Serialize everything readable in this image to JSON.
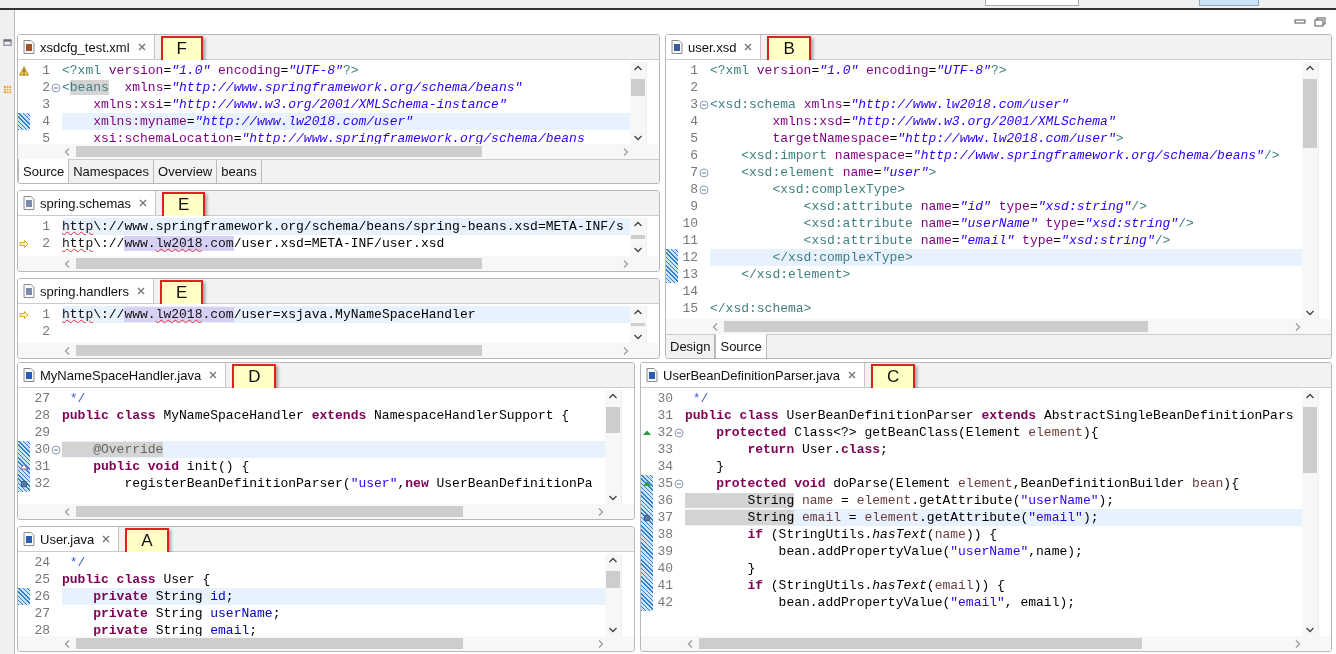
{
  "top": {
    "left": [
      {
        "file": "xsdcfg_test.xml",
        "kind": "xml",
        "callout": "F",
        "lines": [
          {
            "no": "1",
            "markers": [
              {
                "kind": "warning"
              }
            ],
            "fold": false,
            "current": false,
            "tokens": [
              {
                "kind": "tag",
                "text": "<?xml "
              },
              {
                "kind": "attr",
                "text": "version"
              },
              {
                "kind": "plain",
                "text": "="
              },
              {
                "kind": "string",
                "text": "\"1.0\""
              },
              {
                "kind": "attr",
                "text": " encoding"
              },
              {
                "kind": "plain",
                "text": "="
              },
              {
                "kind": "string",
                "text": "\"UTF-8\""
              },
              {
                "kind": "tag",
                "text": "?>"
              }
            ]
          },
          {
            "no": "2",
            "fold": true,
            "current": false,
            "tokens": [
              {
                "kind": "tag",
                "text": "<"
              },
              {
                "kind": "tag_occurrence",
                "text": "beans"
              },
              {
                "kind": "attr",
                "text": "  xmlns"
              },
              {
                "kind": "plain",
                "text": "="
              },
              {
                "kind": "string",
                "text": "\"http://www.springframework.org/schema/beans\""
              }
            ]
          },
          {
            "no": "3",
            "fold": false,
            "current": false,
            "tokens": [
              {
                "kind": "attr",
                "text": "    xmlns:xsi"
              },
              {
                "kind": "plain",
                "text": "="
              },
              {
                "kind": "string",
                "text": "\"http://www.w3.org/2001/XMLSchema-instance\""
              }
            ]
          },
          {
            "no": "4",
            "markers": [
              {
                "kind": "hatch"
              }
            ],
            "fold": false,
            "current": true,
            "tokens": [
              {
                "kind": "attr",
                "text": "    xmlns:myname"
              },
              {
                "kind": "plain",
                "text": "="
              },
              {
                "kind": "string",
                "text": "\"http://www.lw2018.com/user\""
              }
            ]
          },
          {
            "no": "5",
            "fold": false,
            "current": false,
            "tokens": [
              {
                "kind": "attr",
                "text": "    xsi:schemaLocation"
              },
              {
                "kind": "plain",
                "text": "="
              },
              {
                "kind": "string",
                "text": "\"http://www.springframework.org/schema/beans"
              }
            ]
          }
        ],
        "pages": [
          {
            "label": "Source",
            "selected": true
          },
          {
            "label": "Namespaces",
            "selected": false
          },
          {
            "label": "Overview",
            "selected": false
          },
          {
            "label": "beans",
            "selected": false
          }
        ]
      },
      {
        "file": "spring.schemas",
        "kind": "text",
        "callout": "E",
        "lines": [
          {
            "no": "1",
            "fold": false,
            "current": true,
            "tokens": [
              {
                "kind": "squiggle",
                "text": "http"
              },
              {
                "kind": "plain",
                "text": "\\://www.springframework.org/schema/beans/spring-beans.xsd=META-INF/s"
              }
            ]
          },
          {
            "no": "2",
            "markers": [
              {
                "kind": "arrow"
              }
            ],
            "fold": false,
            "current": false,
            "tokens": [
              {
                "kind": "squiggle",
                "text": "http"
              },
              {
                "kind": "plain",
                "text": "\\://"
              },
              {
                "kind": "selected",
                "text": "www."
              },
              {
                "kind": "selected_squiggle",
                "text": "lw2018"
              },
              {
                "kind": "selected",
                "text": ".com"
              },
              {
                "kind": "plain",
                "text": "/user.xsd=META-INF/user.xsd"
              }
            ]
          }
        ]
      },
      {
        "file": "spring.handlers",
        "kind": "text",
        "callout": "E",
        "lines": [
          {
            "no": "1",
            "markers": [
              {
                "kind": "arrow"
              }
            ],
            "fold": false,
            "current": true,
            "tokens": [
              {
                "kind": "squiggle",
                "text": "http"
              },
              {
                "kind": "plain",
                "text": "\\://"
              },
              {
                "kind": "selected",
                "text": "www."
              },
              {
                "kind": "selected_squiggle",
                "text": "lw2018"
              },
              {
                "kind": "selected",
                "text": ".com"
              },
              {
                "kind": "plain",
                "text": "/user=xsjava.MyNameSpaceHandler"
              }
            ]
          },
          {
            "no": "2",
            "fold": false,
            "current": false
          }
        ]
      }
    ],
    "right": [
      {
        "file": "user.xsd",
        "kind": "xsd",
        "callout": "B",
        "lines": [
          {
            "no": "1",
            "fold": false,
            "current": false,
            "tokens": [
              {
                "kind": "tag",
                "text": "<?xml "
              },
              {
                "kind": "attr",
                "text": "version"
              },
              {
                "kind": "plain",
                "text": "="
              },
              {
                "kind": "string",
                "text": "\"1.0\""
              },
              {
                "kind": "attr",
                "text": " encoding"
              },
              {
                "kind": "plain",
                "text": "="
              },
              {
                "kind": "string",
                "text": "\"UTF-8\""
              },
              {
                "kind": "tag",
                "text": "?>"
              }
            ]
          },
          {
            "no": "2",
            "fold": false,
            "current": false
          },
          {
            "no": "3",
            "fold": true,
            "current": false,
            "tokens": [
              {
                "kind": "tag",
                "text": "<xsd:schema "
              },
              {
                "kind": "attr",
                "text": "xmlns"
              },
              {
                "kind": "plain",
                "text": "="
              },
              {
                "kind": "string",
                "text": "\"http://www.lw2018.com/user\""
              }
            ]
          },
          {
            "no": "4",
            "fold": false,
            "current": false,
            "tokens": [
              {
                "kind": "attr",
                "text": "        xmlns:xsd"
              },
              {
                "kind": "plain",
                "text": "="
              },
              {
                "kind": "string",
                "text": "\"http://www.w3.org/2001/XMLSchema\""
              }
            ]
          },
          {
            "no": "5",
            "fold": false,
            "current": false,
            "tokens": [
              {
                "kind": "attr",
                "text": "        targetNamespace"
              },
              {
                "kind": "plain",
                "text": "="
              },
              {
                "kind": "string",
                "text": "\"http://www.lw2018.com/user\""
              },
              {
                "kind": "tag",
                "text": ">"
              }
            ]
          },
          {
            "no": "6",
            "fold": false,
            "current": false,
            "tokens": [
              {
                "kind": "tag",
                "text": "    <xsd:import "
              },
              {
                "kind": "attr",
                "text": "namespace"
              },
              {
                "kind": "plain",
                "text": "="
              },
              {
                "kind": "string",
                "text": "\"http://www.springframework.org/schema/beans\""
              },
              {
                "kind": "tag",
                "text": "/>"
              }
            ]
          },
          {
            "no": "7",
            "fold": true,
            "current": false,
            "tokens": [
              {
                "kind": "tag",
                "text": "    <xsd:element "
              },
              {
                "kind": "attr",
                "text": "name"
              },
              {
                "kind": "plain",
                "text": "="
              },
              {
                "kind": "string",
                "text": "\"user\""
              },
              {
                "kind": "tag",
                "text": ">"
              }
            ]
          },
          {
            "no": "8",
            "fold": true,
            "current": false,
            "tokens": [
              {
                "kind": "tag",
                "text": "        <xsd:complexType>"
              }
            ]
          },
          {
            "no": "9",
            "fold": false,
            "current": false,
            "tokens": [
              {
                "kind": "tag",
                "text": "            <xsd:attribute "
              },
              {
                "kind": "attr",
                "text": "name"
              },
              {
                "kind": "plain",
                "text": "="
              },
              {
                "kind": "string",
                "text": "\"id\""
              },
              {
                "kind": "attr",
                "text": " type"
              },
              {
                "kind": "plain",
                "text": "="
              },
              {
                "kind": "string",
                "text": "\"xsd:string\""
              },
              {
                "kind": "tag",
                "text": "/>"
              }
            ]
          },
          {
            "no": "10",
            "fold": false,
            "current": false,
            "tokens": [
              {
                "kind": "tag",
                "text": "            <xsd:attribute "
              },
              {
                "kind": "attr",
                "text": "name"
              },
              {
                "kind": "plain",
                "text": "="
              },
              {
                "kind": "string",
                "text": "\"userName\""
              },
              {
                "kind": "attr",
                "text": " type"
              },
              {
                "kind": "plain",
                "text": "="
              },
              {
                "kind": "string",
                "text": "\"xsd:string\""
              },
              {
                "kind": "tag",
                "text": "/>"
              }
            ]
          },
          {
            "no": "11",
            "fold": false,
            "current": false,
            "tokens": [
              {
                "kind": "tag",
                "text": "            <xsd:attribute "
              },
              {
                "kind": "attr",
                "text": "name"
              },
              {
                "kind": "plain",
                "text": "="
              },
              {
                "kind": "string",
                "text": "\"email\""
              },
              {
                "kind": "attr",
                "text": " type"
              },
              {
                "kind": "plain",
                "text": "="
              },
              {
                "kind": "string",
                "text": "\"xsd:string\""
              },
              {
                "kind": "tag",
                "text": "/>"
              }
            ]
          },
          {
            "no": "12",
            "markers": [
              {
                "kind": "hatch"
              }
            ],
            "fold": false,
            "current": true,
            "tokens": [
              {
                "kind": "tag",
                "text": "        </xsd:complexType>"
              }
            ]
          },
          {
            "no": "13",
            "markers": [
              {
                "kind": "hatch"
              }
            ],
            "fold": false,
            "current": false,
            "tokens": [
              {
                "kind": "tag",
                "text": "    </xsd:element>"
              }
            ]
          },
          {
            "no": "14",
            "fold": false,
            "current": false
          },
          {
            "no": "15",
            "fold": false,
            "current": false,
            "tokens": [
              {
                "kind": "tag",
                "text": "</xsd:schema>"
              }
            ]
          }
        ],
        "pages": [
          {
            "label": "Design",
            "selected": false
          },
          {
            "label": "Source",
            "selected": true
          }
        ]
      }
    ]
  },
  "bottom": {
    "left": [
      {
        "file": "MyNameSpaceHandler.java",
        "kind": "java",
        "callout": "D",
        "lines": [
          {
            "no": "27",
            "fold": false,
            "current": false,
            "tokens": [
              {
                "kind": "comment",
                "text": " */"
              }
            ]
          },
          {
            "no": "28",
            "fold": false,
            "current": false,
            "tokens": [
              {
                "kind": "keyword",
                "text": "public"
              },
              {
                "kind": "keyword",
                "text": " class"
              },
              {
                "kind": "plain",
                "text": " MyNameSpaceHandler "
              },
              {
                "kind": "keyword",
                "text": "extends"
              },
              {
                "kind": "plain",
                "text": " NamespaceHandlerSupport {"
              }
            ]
          },
          {
            "no": "29",
            "fold": false,
            "current": false
          },
          {
            "no": "30",
            "markers": [
              {
                "kind": "hatch"
              }
            ],
            "fold": true,
            "current": true,
            "tokens": [
              {
                "kind": "annotation",
                "text": "    @Override"
              }
            ]
          },
          {
            "no": "31",
            "markers": [
              {
                "kind": "hatch"
              },
              {
                "kind": "implements"
              }
            ],
            "fold": false,
            "current": false,
            "tokens": [
              {
                "kind": "keyword",
                "text": "    public"
              },
              {
                "kind": "keyword",
                "text": " void"
              },
              {
                "kind": "plain",
                "text": " init() {"
              }
            ]
          },
          {
            "no": "32",
            "markers": [
              {
                "kind": "hatch"
              },
              {
                "kind": "dot"
              }
            ],
            "fold": false,
            "current": false,
            "tokens": [
              {
                "kind": "plain",
                "text": "        registerBeanDefinitionParser("
              },
              {
                "kind": "java_string",
                "text": "\"user\""
              },
              {
                "kind": "plain",
                "text": ","
              },
              {
                "kind": "keyword",
                "text": "new"
              },
              {
                "kind": "plain",
                "text": " UserBeanDefinitionPa"
              }
            ]
          }
        ]
      },
      {
        "file": "User.java",
        "kind": "java",
        "callout": "A",
        "lines": [
          {
            "no": "24",
            "fold": false,
            "current": false,
            "tokens": [
              {
                "kind": "comment",
                "text": " */"
              }
            ]
          },
          {
            "no": "25",
            "fold": false,
            "current": false,
            "tokens": [
              {
                "kind": "keyword",
                "text": "public"
              },
              {
                "kind": "keyword",
                "text": " class"
              },
              {
                "kind": "plain",
                "text": " User {"
              }
            ]
          },
          {
            "no": "26",
            "markers": [
              {
                "kind": "hatch"
              }
            ],
            "fold": false,
            "current": true,
            "tokens": [
              {
                "kind": "keyword",
                "text": "    private"
              },
              {
                "kind": "plain",
                "text": " String "
              },
              {
                "kind": "field",
                "text": "id"
              },
              {
                "kind": "plain",
                "text": ";"
              }
            ]
          },
          {
            "no": "27",
            "fold": false,
            "current": false,
            "tokens": [
              {
                "kind": "keyword",
                "text": "    private"
              },
              {
                "kind": "plain",
                "text": " String "
              },
              {
                "kind": "field",
                "text": "userName"
              },
              {
                "kind": "plain",
                "text": ";"
              }
            ]
          },
          {
            "no": "28",
            "fold": false,
            "current": false,
            "tokens": [
              {
                "kind": "keyword",
                "text": "    private"
              },
              {
                "kind": "plain",
                "text": " String "
              },
              {
                "kind": "field",
                "text": "email"
              },
              {
                "kind": "plain",
                "text": ";"
              }
            ]
          }
        ]
      }
    ],
    "right": [
      {
        "file": "UserBeanDefinitionParser.java",
        "kind": "java",
        "callout": "C",
        "lines": [
          {
            "no": "30",
            "fold": false,
            "current": false,
            "tokens": [
              {
                "kind": "comment",
                "text": " */"
              }
            ]
          },
          {
            "no": "31",
            "fold": false,
            "current": false,
            "tokens": [
              {
                "kind": "keyword",
                "text": "public"
              },
              {
                "kind": "keyword",
                "text": " class"
              },
              {
                "kind": "plain",
                "text": " UserBeanDefinitionParser "
              },
              {
                "kind": "keyword",
                "text": "extends"
              },
              {
                "kind": "plain",
                "text": " AbstractSingleBeanDefinitionPars"
              }
            ]
          },
          {
            "no": "32",
            "markers": [
              {
                "kind": "override"
              }
            ],
            "fold": true,
            "current": false,
            "tokens": [
              {
                "kind": "keyword",
                "text": "    protected"
              },
              {
                "kind": "plain",
                "text": " Class<?> getBeanClass(Element "
              },
              {
                "kind": "variable",
                "text": "element"
              },
              {
                "kind": "plain",
                "text": "){"
              }
            ]
          },
          {
            "no": "33",
            "fold": false,
            "current": false,
            "tokens": [
              {
                "kind": "keyword",
                "text": "        return"
              },
              {
                "kind": "plain",
                "text": " User."
              },
              {
                "kind": "keyword",
                "text": "class"
              },
              {
                "kind": "plain",
                "text": ";"
              }
            ]
          },
          {
            "no": "34",
            "fold": false,
            "current": false,
            "tokens": [
              {
                "kind": "plain",
                "text": "    }"
              }
            ]
          },
          {
            "no": "35",
            "markers": [
              {
                "kind": "hatch"
              },
              {
                "kind": "override"
              }
            ],
            "fold": true,
            "current": false,
            "tokens": [
              {
                "kind": "keyword",
                "text": "    protected"
              },
              {
                "kind": "keyword",
                "text": " void"
              },
              {
                "kind": "plain",
                "text": " doParse(Element "
              },
              {
                "kind": "variable",
                "text": "element"
              },
              {
                "kind": "plain",
                "text": ",BeanDefinitionBuilder "
              },
              {
                "kind": "variable",
                "text": "bean"
              },
              {
                "kind": "plain",
                "text": "){"
              }
            ]
          },
          {
            "no": "36",
            "markers": [
              {
                "kind": "hatch"
              }
            ],
            "fold": false,
            "current": false,
            "tokens": [
              {
                "kind": "occurrence",
                "text": "        String"
              },
              {
                "kind": "variable",
                "text": " name"
              },
              {
                "kind": "plain",
                "text": " = "
              },
              {
                "kind": "variable",
                "text": "element"
              },
              {
                "kind": "plain",
                "text": ".getAttribute("
              },
              {
                "kind": "java_string",
                "text": "\"userName\""
              },
              {
                "kind": "plain",
                "text": ");"
              }
            ]
          },
          {
            "no": "37",
            "markers": [
              {
                "kind": "hatch"
              },
              {
                "kind": "dot"
              }
            ],
            "fold": false,
            "current": true,
            "tokens": [
              {
                "kind": "occurrence",
                "text": "        String"
              },
              {
                "kind": "variable",
                "text": " email"
              },
              {
                "kind": "plain",
                "text": " = "
              },
              {
                "kind": "variable",
                "text": "element"
              },
              {
                "kind": "plain",
                "text": ".getAttribute("
              },
              {
                "kind": "java_string",
                "text": "\"email\""
              },
              {
                "kind": "plain",
                "text": ");"
              }
            ]
          },
          {
            "no": "38",
            "markers": [
              {
                "kind": "hatch"
              }
            ],
            "fold": false,
            "current": false,
            "tokens": [
              {
                "kind": "keyword",
                "text": "        if"
              },
              {
                "kind": "plain",
                "text": " (StringUtils."
              },
              {
                "kind": "italic",
                "text": "hasText"
              },
              {
                "kind": "plain",
                "text": "("
              },
              {
                "kind": "variable",
                "text": "name"
              },
              {
                "kind": "plain",
                "text": ")) {"
              }
            ]
          },
          {
            "no": "39",
            "markers": [
              {
                "kind": "hatch"
              }
            ],
            "fold": false,
            "current": false,
            "tokens": [
              {
                "kind": "plain",
                "text": "            bean.addPropertyValue("
              },
              {
                "kind": "java_string",
                "text": "\"userName\""
              },
              {
                "kind": "plain",
                "text": ",name);"
              }
            ]
          },
          {
            "no": "40",
            "markers": [
              {
                "kind": "hatch"
              }
            ],
            "fold": false,
            "current": false,
            "tokens": [
              {
                "kind": "plain",
                "text": "        }"
              }
            ]
          },
          {
            "no": "41",
            "markers": [
              {
                "kind": "hatch"
              }
            ],
            "fold": false,
            "current": false,
            "tokens": [
              {
                "kind": "keyword",
                "text": "        if"
              },
              {
                "kind": "plain",
                "text": " (StringUtils."
              },
              {
                "kind": "italic",
                "text": "hasText"
              },
              {
                "kind": "plain",
                "text": "("
              },
              {
                "kind": "variable",
                "text": "email"
              },
              {
                "kind": "plain",
                "text": ")) {"
              }
            ]
          },
          {
            "no": "42",
            "markers": [
              {
                "kind": "hatch"
              }
            ],
            "fold": false,
            "current": false,
            "tokens": [
              {
                "kind": "plain",
                "text": "            bean.addPropertyValue("
              },
              {
                "kind": "java_string",
                "text": "\"email\""
              },
              {
                "kind": "plain",
                "text": ", email);"
              }
            ]
          }
        ]
      }
    ]
  }
}
